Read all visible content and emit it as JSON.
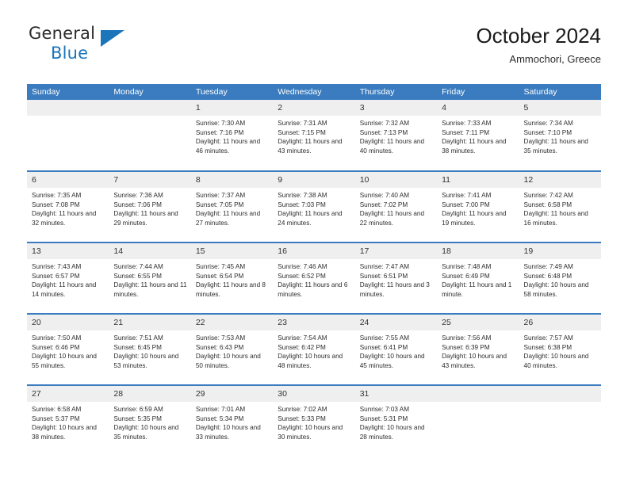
{
  "brand": {
    "word_one": "General",
    "word_two": "Blue"
  },
  "header": {
    "title": "October 2024",
    "subtitle": "Ammochori, Greece"
  },
  "colors": {
    "header_blue": "#3a7cbf",
    "brand_blue": "#1b75bb",
    "daynum_band": "#efefef",
    "text": "#2e2e2e"
  },
  "calendar": {
    "weekday_headers": [
      "Sunday",
      "Monday",
      "Tuesday",
      "Wednesday",
      "Thursday",
      "Friday",
      "Saturday"
    ],
    "weeks": [
      [
        {
          "day": ""
        },
        {
          "day": ""
        },
        {
          "day": "1",
          "sunrise": "Sunrise: 7:30 AM",
          "sunset": "Sunset: 7:16 PM",
          "daylight": "Daylight: 11 hours and 46 minutes."
        },
        {
          "day": "2",
          "sunrise": "Sunrise: 7:31 AM",
          "sunset": "Sunset: 7:15 PM",
          "daylight": "Daylight: 11 hours and 43 minutes."
        },
        {
          "day": "3",
          "sunrise": "Sunrise: 7:32 AM",
          "sunset": "Sunset: 7:13 PM",
          "daylight": "Daylight: 11 hours and 40 minutes."
        },
        {
          "day": "4",
          "sunrise": "Sunrise: 7:33 AM",
          "sunset": "Sunset: 7:11 PM",
          "daylight": "Daylight: 11 hours and 38 minutes."
        },
        {
          "day": "5",
          "sunrise": "Sunrise: 7:34 AM",
          "sunset": "Sunset: 7:10 PM",
          "daylight": "Daylight: 11 hours and 35 minutes."
        }
      ],
      [
        {
          "day": "6",
          "sunrise": "Sunrise: 7:35 AM",
          "sunset": "Sunset: 7:08 PM",
          "daylight": "Daylight: 11 hours and 32 minutes."
        },
        {
          "day": "7",
          "sunrise": "Sunrise: 7:36 AM",
          "sunset": "Sunset: 7:06 PM",
          "daylight": "Daylight: 11 hours and 29 minutes."
        },
        {
          "day": "8",
          "sunrise": "Sunrise: 7:37 AM",
          "sunset": "Sunset: 7:05 PM",
          "daylight": "Daylight: 11 hours and 27 minutes."
        },
        {
          "day": "9",
          "sunrise": "Sunrise: 7:38 AM",
          "sunset": "Sunset: 7:03 PM",
          "daylight": "Daylight: 11 hours and 24 minutes."
        },
        {
          "day": "10",
          "sunrise": "Sunrise: 7:40 AM",
          "sunset": "Sunset: 7:02 PM",
          "daylight": "Daylight: 11 hours and 22 minutes."
        },
        {
          "day": "11",
          "sunrise": "Sunrise: 7:41 AM",
          "sunset": "Sunset: 7:00 PM",
          "daylight": "Daylight: 11 hours and 19 minutes."
        },
        {
          "day": "12",
          "sunrise": "Sunrise: 7:42 AM",
          "sunset": "Sunset: 6:58 PM",
          "daylight": "Daylight: 11 hours and 16 minutes."
        }
      ],
      [
        {
          "day": "13",
          "sunrise": "Sunrise: 7:43 AM",
          "sunset": "Sunset: 6:57 PM",
          "daylight": "Daylight: 11 hours and 14 minutes."
        },
        {
          "day": "14",
          "sunrise": "Sunrise: 7:44 AM",
          "sunset": "Sunset: 6:55 PM",
          "daylight": "Daylight: 11 hours and 11 minutes."
        },
        {
          "day": "15",
          "sunrise": "Sunrise: 7:45 AM",
          "sunset": "Sunset: 6:54 PM",
          "daylight": "Daylight: 11 hours and 8 minutes."
        },
        {
          "day": "16",
          "sunrise": "Sunrise: 7:46 AM",
          "sunset": "Sunset: 6:52 PM",
          "daylight": "Daylight: 11 hours and 6 minutes."
        },
        {
          "day": "17",
          "sunrise": "Sunrise: 7:47 AM",
          "sunset": "Sunset: 6:51 PM",
          "daylight": "Daylight: 11 hours and 3 minutes."
        },
        {
          "day": "18",
          "sunrise": "Sunrise: 7:48 AM",
          "sunset": "Sunset: 6:49 PM",
          "daylight": "Daylight: 11 hours and 1 minute."
        },
        {
          "day": "19",
          "sunrise": "Sunrise: 7:49 AM",
          "sunset": "Sunset: 6:48 PM",
          "daylight": "Daylight: 10 hours and 58 minutes."
        }
      ],
      [
        {
          "day": "20",
          "sunrise": "Sunrise: 7:50 AM",
          "sunset": "Sunset: 6:46 PM",
          "daylight": "Daylight: 10 hours and 55 minutes."
        },
        {
          "day": "21",
          "sunrise": "Sunrise: 7:51 AM",
          "sunset": "Sunset: 6:45 PM",
          "daylight": "Daylight: 10 hours and 53 minutes."
        },
        {
          "day": "22",
          "sunrise": "Sunrise: 7:53 AM",
          "sunset": "Sunset: 6:43 PM",
          "daylight": "Daylight: 10 hours and 50 minutes."
        },
        {
          "day": "23",
          "sunrise": "Sunrise: 7:54 AM",
          "sunset": "Sunset: 6:42 PM",
          "daylight": "Daylight: 10 hours and 48 minutes."
        },
        {
          "day": "24",
          "sunrise": "Sunrise: 7:55 AM",
          "sunset": "Sunset: 6:41 PM",
          "daylight": "Daylight: 10 hours and 45 minutes."
        },
        {
          "day": "25",
          "sunrise": "Sunrise: 7:56 AM",
          "sunset": "Sunset: 6:39 PM",
          "daylight": "Daylight: 10 hours and 43 minutes."
        },
        {
          "day": "26",
          "sunrise": "Sunrise: 7:57 AM",
          "sunset": "Sunset: 6:38 PM",
          "daylight": "Daylight: 10 hours and 40 minutes."
        }
      ],
      [
        {
          "day": "27",
          "sunrise": "Sunrise: 6:58 AM",
          "sunset": "Sunset: 5:37 PM",
          "daylight": "Daylight: 10 hours and 38 minutes."
        },
        {
          "day": "28",
          "sunrise": "Sunrise: 6:59 AM",
          "sunset": "Sunset: 5:35 PM",
          "daylight": "Daylight: 10 hours and 35 minutes."
        },
        {
          "day": "29",
          "sunrise": "Sunrise: 7:01 AM",
          "sunset": "Sunset: 5:34 PM",
          "daylight": "Daylight: 10 hours and 33 minutes."
        },
        {
          "day": "30",
          "sunrise": "Sunrise: 7:02 AM",
          "sunset": "Sunset: 5:33 PM",
          "daylight": "Daylight: 10 hours and 30 minutes."
        },
        {
          "day": "31",
          "sunrise": "Sunrise: 7:03 AM",
          "sunset": "Sunset: 5:31 PM",
          "daylight": "Daylight: 10 hours and 28 minutes."
        },
        {
          "day": ""
        },
        {
          "day": ""
        }
      ]
    ]
  }
}
